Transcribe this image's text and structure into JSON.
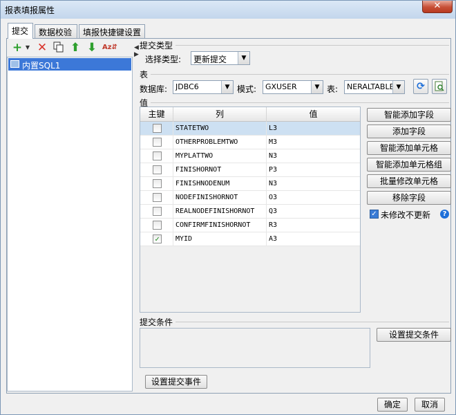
{
  "window": {
    "title": "报表填报属性",
    "close_glyph": "✕"
  },
  "tabs": [
    {
      "label": "提交"
    },
    {
      "label": "数据校验"
    },
    {
      "label": "填报快捷键设置"
    }
  ],
  "toolbar": {
    "icons": [
      "add-icon",
      "delete-icon",
      "copy-icon",
      "move-up-icon",
      "move-down-icon",
      "sort-icon"
    ]
  },
  "tree": {
    "item_label": "内置SQL1"
  },
  "submit_type": {
    "section": "提交类型",
    "label": "选择类型:",
    "value": "更新提交"
  },
  "table_section": {
    "section": "表",
    "db_label": "数据库:",
    "db_value": "JDBC6",
    "mode_label": "模式:",
    "mode_value": "GXUSER",
    "table_label": "表:",
    "table_value": "NERALTABLE"
  },
  "values_section": {
    "section": "值",
    "headers": {
      "key": "主键",
      "column": "列",
      "value": "值"
    },
    "rows": [
      {
        "key": false,
        "column": "STATETWO",
        "value": "L3",
        "selected": true
      },
      {
        "key": false,
        "column": "OTHERPROBLEMTWO",
        "value": "M3"
      },
      {
        "key": false,
        "column": "MYPLATTWO",
        "value": "N3"
      },
      {
        "key": false,
        "column": "FINISHORNOT",
        "value": "P3"
      },
      {
        "key": false,
        "column": "FINISHNODENUM",
        "value": "N3"
      },
      {
        "key": false,
        "column": "NODEFINISHORNOT",
        "value": "O3"
      },
      {
        "key": false,
        "column": "REALNODEFINISHORNOT",
        "value": "Q3"
      },
      {
        "key": false,
        "column": "CONFIRMFINISHORNOT",
        "value": "R3"
      },
      {
        "key": true,
        "column": "MYID",
        "value": "A3"
      }
    ]
  },
  "actions": {
    "smart_add_field": "智能添加字段",
    "add_field": "添加字段",
    "smart_add_cell": "智能添加单元格",
    "smart_add_cell_group": "智能添加单元格组",
    "batch_modify_cell": "批量修改单元格",
    "remove_field": "移除字段",
    "unmodified_no_update": "未修改不更新"
  },
  "condition": {
    "section": "提交条件",
    "button": "设置提交条件"
  },
  "event_button": "设置提交事件",
  "footer": {
    "ok": "确定",
    "cancel": "取消"
  }
}
